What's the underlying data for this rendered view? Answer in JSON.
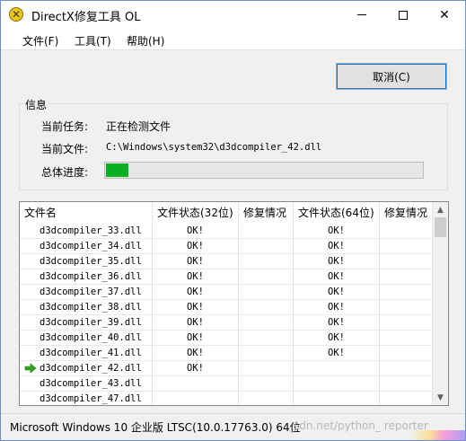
{
  "window": {
    "title": "DirectX修复工具 OL",
    "controls": {
      "minimize": "—",
      "maximize": "☐",
      "close": "✕"
    }
  },
  "menu": [
    {
      "label": "文件(F)"
    },
    {
      "label": "工具(T)"
    },
    {
      "label": "帮助(H)"
    }
  ],
  "cancel_button": {
    "label": "取消(C)"
  },
  "info": {
    "group_title": "信息",
    "task_label": "当前任务:",
    "task_value": "正在检测文件",
    "file_label": "当前文件:",
    "file_value": "C:\\Windows\\system32\\d3dcompiler_42.dll",
    "progress_label": "总体进度:",
    "progress_fraction": 0.07,
    "progress_color": "#06b025"
  },
  "list": {
    "columns": [
      "文件名",
      "文件状态(32位)",
      "修复情况",
      "文件状态(64位)",
      "修复情况"
    ],
    "current_marker_icon": "green-right-arrow-icon",
    "rows": [
      {
        "name": "d3dcompiler_33.dll",
        "status32": "OK!",
        "repair32": "",
        "status64": "OK!",
        "repair64": "",
        "current": false
      },
      {
        "name": "d3dcompiler_34.dll",
        "status32": "OK!",
        "repair32": "",
        "status64": "OK!",
        "repair64": "",
        "current": false
      },
      {
        "name": "d3dcompiler_35.dll",
        "status32": "OK!",
        "repair32": "",
        "status64": "OK!",
        "repair64": "",
        "current": false
      },
      {
        "name": "d3dcompiler_36.dll",
        "status32": "OK!",
        "repair32": "",
        "status64": "OK!",
        "repair64": "",
        "current": false
      },
      {
        "name": "d3dcompiler_37.dll",
        "status32": "OK!",
        "repair32": "",
        "status64": "OK!",
        "repair64": "",
        "current": false
      },
      {
        "name": "d3dcompiler_38.dll",
        "status32": "OK!",
        "repair32": "",
        "status64": "OK!",
        "repair64": "",
        "current": false
      },
      {
        "name": "d3dcompiler_39.dll",
        "status32": "OK!",
        "repair32": "",
        "status64": "OK!",
        "repair64": "",
        "current": false
      },
      {
        "name": "d3dcompiler_40.dll",
        "status32": "OK!",
        "repair32": "",
        "status64": "OK!",
        "repair64": "",
        "current": false
      },
      {
        "name": "d3dcompiler_41.dll",
        "status32": "OK!",
        "repair32": "",
        "status64": "OK!",
        "repair64": "",
        "current": false
      },
      {
        "name": "d3dcompiler_42.dll",
        "status32": "OK!",
        "repair32": "",
        "status64": "",
        "repair64": "",
        "current": true
      },
      {
        "name": "d3dcompiler_43.dll",
        "status32": "",
        "repair32": "",
        "status64": "",
        "repair64": "",
        "current": false
      },
      {
        "name": "d3dcompiler_47.dll",
        "status32": "",
        "repair32": "",
        "status64": "",
        "repair64": "",
        "current": false
      }
    ]
  },
  "scrollbar": {
    "up": "▲",
    "down": "▼"
  },
  "status_bar": {
    "text": "Microsoft Windows 10 企业版 LTSC(10.0.17763.0) 64位",
    "watermark": "sdn.net/python_    reporter"
  }
}
